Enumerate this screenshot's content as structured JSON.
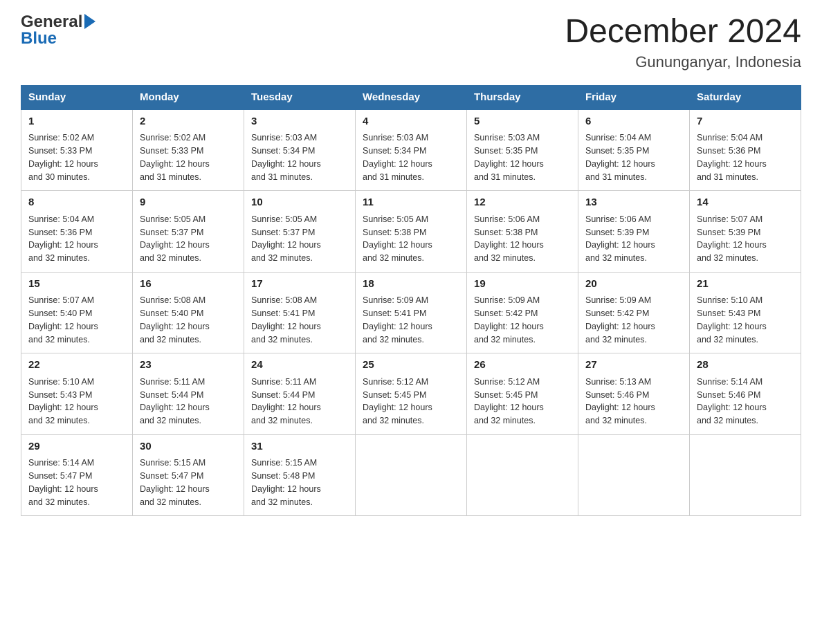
{
  "header": {
    "logo_general": "General",
    "logo_blue": "Blue",
    "month_title": "December 2024",
    "location": "Gununganyar, Indonesia"
  },
  "days_header": [
    "Sunday",
    "Monday",
    "Tuesday",
    "Wednesday",
    "Thursday",
    "Friday",
    "Saturday"
  ],
  "weeks": [
    [
      {
        "day": "1",
        "sunrise": "5:02 AM",
        "sunset": "5:33 PM",
        "daylight": "12 hours and 30 minutes."
      },
      {
        "day": "2",
        "sunrise": "5:02 AM",
        "sunset": "5:33 PM",
        "daylight": "12 hours and 31 minutes."
      },
      {
        "day": "3",
        "sunrise": "5:03 AM",
        "sunset": "5:34 PM",
        "daylight": "12 hours and 31 minutes."
      },
      {
        "day": "4",
        "sunrise": "5:03 AM",
        "sunset": "5:34 PM",
        "daylight": "12 hours and 31 minutes."
      },
      {
        "day": "5",
        "sunrise": "5:03 AM",
        "sunset": "5:35 PM",
        "daylight": "12 hours and 31 minutes."
      },
      {
        "day": "6",
        "sunrise": "5:04 AM",
        "sunset": "5:35 PM",
        "daylight": "12 hours and 31 minutes."
      },
      {
        "day": "7",
        "sunrise": "5:04 AM",
        "sunset": "5:36 PM",
        "daylight": "12 hours and 31 minutes."
      }
    ],
    [
      {
        "day": "8",
        "sunrise": "5:04 AM",
        "sunset": "5:36 PM",
        "daylight": "12 hours and 32 minutes."
      },
      {
        "day": "9",
        "sunrise": "5:05 AM",
        "sunset": "5:37 PM",
        "daylight": "12 hours and 32 minutes."
      },
      {
        "day": "10",
        "sunrise": "5:05 AM",
        "sunset": "5:37 PM",
        "daylight": "12 hours and 32 minutes."
      },
      {
        "day": "11",
        "sunrise": "5:05 AM",
        "sunset": "5:38 PM",
        "daylight": "12 hours and 32 minutes."
      },
      {
        "day": "12",
        "sunrise": "5:06 AM",
        "sunset": "5:38 PM",
        "daylight": "12 hours and 32 minutes."
      },
      {
        "day": "13",
        "sunrise": "5:06 AM",
        "sunset": "5:39 PM",
        "daylight": "12 hours and 32 minutes."
      },
      {
        "day": "14",
        "sunrise": "5:07 AM",
        "sunset": "5:39 PM",
        "daylight": "12 hours and 32 minutes."
      }
    ],
    [
      {
        "day": "15",
        "sunrise": "5:07 AM",
        "sunset": "5:40 PM",
        "daylight": "12 hours and 32 minutes."
      },
      {
        "day": "16",
        "sunrise": "5:08 AM",
        "sunset": "5:40 PM",
        "daylight": "12 hours and 32 minutes."
      },
      {
        "day": "17",
        "sunrise": "5:08 AM",
        "sunset": "5:41 PM",
        "daylight": "12 hours and 32 minutes."
      },
      {
        "day": "18",
        "sunrise": "5:09 AM",
        "sunset": "5:41 PM",
        "daylight": "12 hours and 32 minutes."
      },
      {
        "day": "19",
        "sunrise": "5:09 AM",
        "sunset": "5:42 PM",
        "daylight": "12 hours and 32 minutes."
      },
      {
        "day": "20",
        "sunrise": "5:09 AM",
        "sunset": "5:42 PM",
        "daylight": "12 hours and 32 minutes."
      },
      {
        "day": "21",
        "sunrise": "5:10 AM",
        "sunset": "5:43 PM",
        "daylight": "12 hours and 32 minutes."
      }
    ],
    [
      {
        "day": "22",
        "sunrise": "5:10 AM",
        "sunset": "5:43 PM",
        "daylight": "12 hours and 32 minutes."
      },
      {
        "day": "23",
        "sunrise": "5:11 AM",
        "sunset": "5:44 PM",
        "daylight": "12 hours and 32 minutes."
      },
      {
        "day": "24",
        "sunrise": "5:11 AM",
        "sunset": "5:44 PM",
        "daylight": "12 hours and 32 minutes."
      },
      {
        "day": "25",
        "sunrise": "5:12 AM",
        "sunset": "5:45 PM",
        "daylight": "12 hours and 32 minutes."
      },
      {
        "day": "26",
        "sunrise": "5:12 AM",
        "sunset": "5:45 PM",
        "daylight": "12 hours and 32 minutes."
      },
      {
        "day": "27",
        "sunrise": "5:13 AM",
        "sunset": "5:46 PM",
        "daylight": "12 hours and 32 minutes."
      },
      {
        "day": "28",
        "sunrise": "5:14 AM",
        "sunset": "5:46 PM",
        "daylight": "12 hours and 32 minutes."
      }
    ],
    [
      {
        "day": "29",
        "sunrise": "5:14 AM",
        "sunset": "5:47 PM",
        "daylight": "12 hours and 32 minutes."
      },
      {
        "day": "30",
        "sunrise": "5:15 AM",
        "sunset": "5:47 PM",
        "daylight": "12 hours and 32 minutes."
      },
      {
        "day": "31",
        "sunrise": "5:15 AM",
        "sunset": "5:48 PM",
        "daylight": "12 hours and 32 minutes."
      },
      null,
      null,
      null,
      null
    ]
  ],
  "labels": {
    "sunrise": "Sunrise:",
    "sunset": "Sunset:",
    "daylight": "Daylight:"
  }
}
